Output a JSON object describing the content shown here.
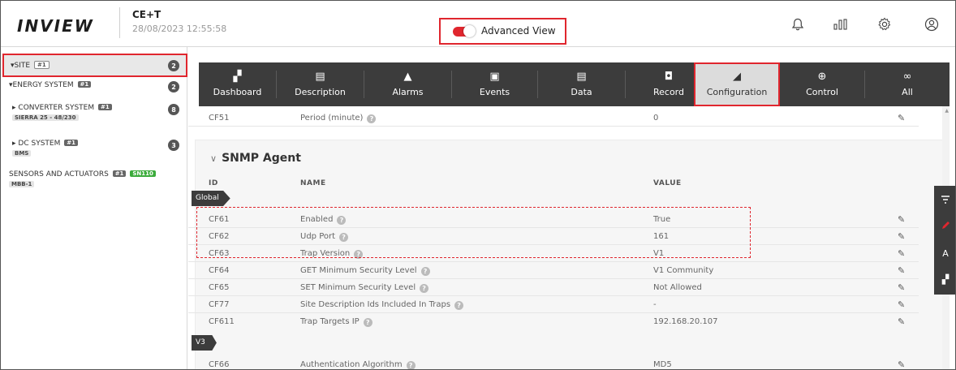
{
  "header": {
    "logo": "INVIEW",
    "site_name": "CE+T",
    "datetime": "28/08/2023 12:55:58",
    "advanced_view_label": "Advanced View",
    "icons": [
      "bell-icon",
      "bar-chart-icon",
      "gear-icon",
      "user-icon"
    ]
  },
  "sidebar": {
    "site": {
      "label": "SITE",
      "badge": "#1",
      "count": "2"
    },
    "energy": {
      "label": "ENERGY SYSTEM",
      "badge": "#1",
      "count": "2"
    },
    "converter": {
      "label": "CONVERTER SYSTEM",
      "badge": "#1",
      "sub": "SIERRA 25 - 48/230",
      "count": "8"
    },
    "dc": {
      "label": "DC SYSTEM",
      "badge": "#1",
      "sub": "BMS",
      "count": "3"
    },
    "sensors": {
      "label": "SENSORS AND ACTUATORS",
      "badge": "#1",
      "badge2": "SN110",
      "sub": "MBB-1"
    }
  },
  "toolbar": {
    "dashboard": "Dashboard",
    "description": "Description",
    "alarms": "Alarms",
    "events": "Events",
    "data": "Data",
    "record": "Record",
    "configuration": "Configuration",
    "control": "Control",
    "all": "All"
  },
  "content": {
    "top_row": {
      "id": "CF51",
      "name": "Period (minute)",
      "value": "0"
    },
    "section_title": "SNMP Agent",
    "columns": {
      "id": "ID",
      "name": "NAME",
      "value": "VALUE"
    },
    "tag_global": "Global",
    "tag_v3": "V3",
    "rows": [
      {
        "id": "CF61",
        "name": "Enabled",
        "value": "True"
      },
      {
        "id": "CF62",
        "name": "Udp Port",
        "value": "161"
      },
      {
        "id": "CF63",
        "name": "Trap Version",
        "value": "V1"
      },
      {
        "id": "CF64",
        "name": "GET Minimum Security Level",
        "value": "V1 Community"
      },
      {
        "id": "CF65",
        "name": "SET Minimum Security Level",
        "value": "Not Allowed"
      },
      {
        "id": "CF77",
        "name": "Site Description Ids Included In Traps",
        "value": "-"
      },
      {
        "id": "CF611",
        "name": "Trap Targets IP",
        "value": "192.168.20.107"
      }
    ],
    "v3_rows": [
      {
        "id": "CF66",
        "name": "Authentication Algorithm",
        "value": "MD5"
      }
    ]
  },
  "colors": {
    "accent": "#e0262e",
    "toolbar": "#3c3c3c",
    "active_tab": "#dcdcdc"
  }
}
